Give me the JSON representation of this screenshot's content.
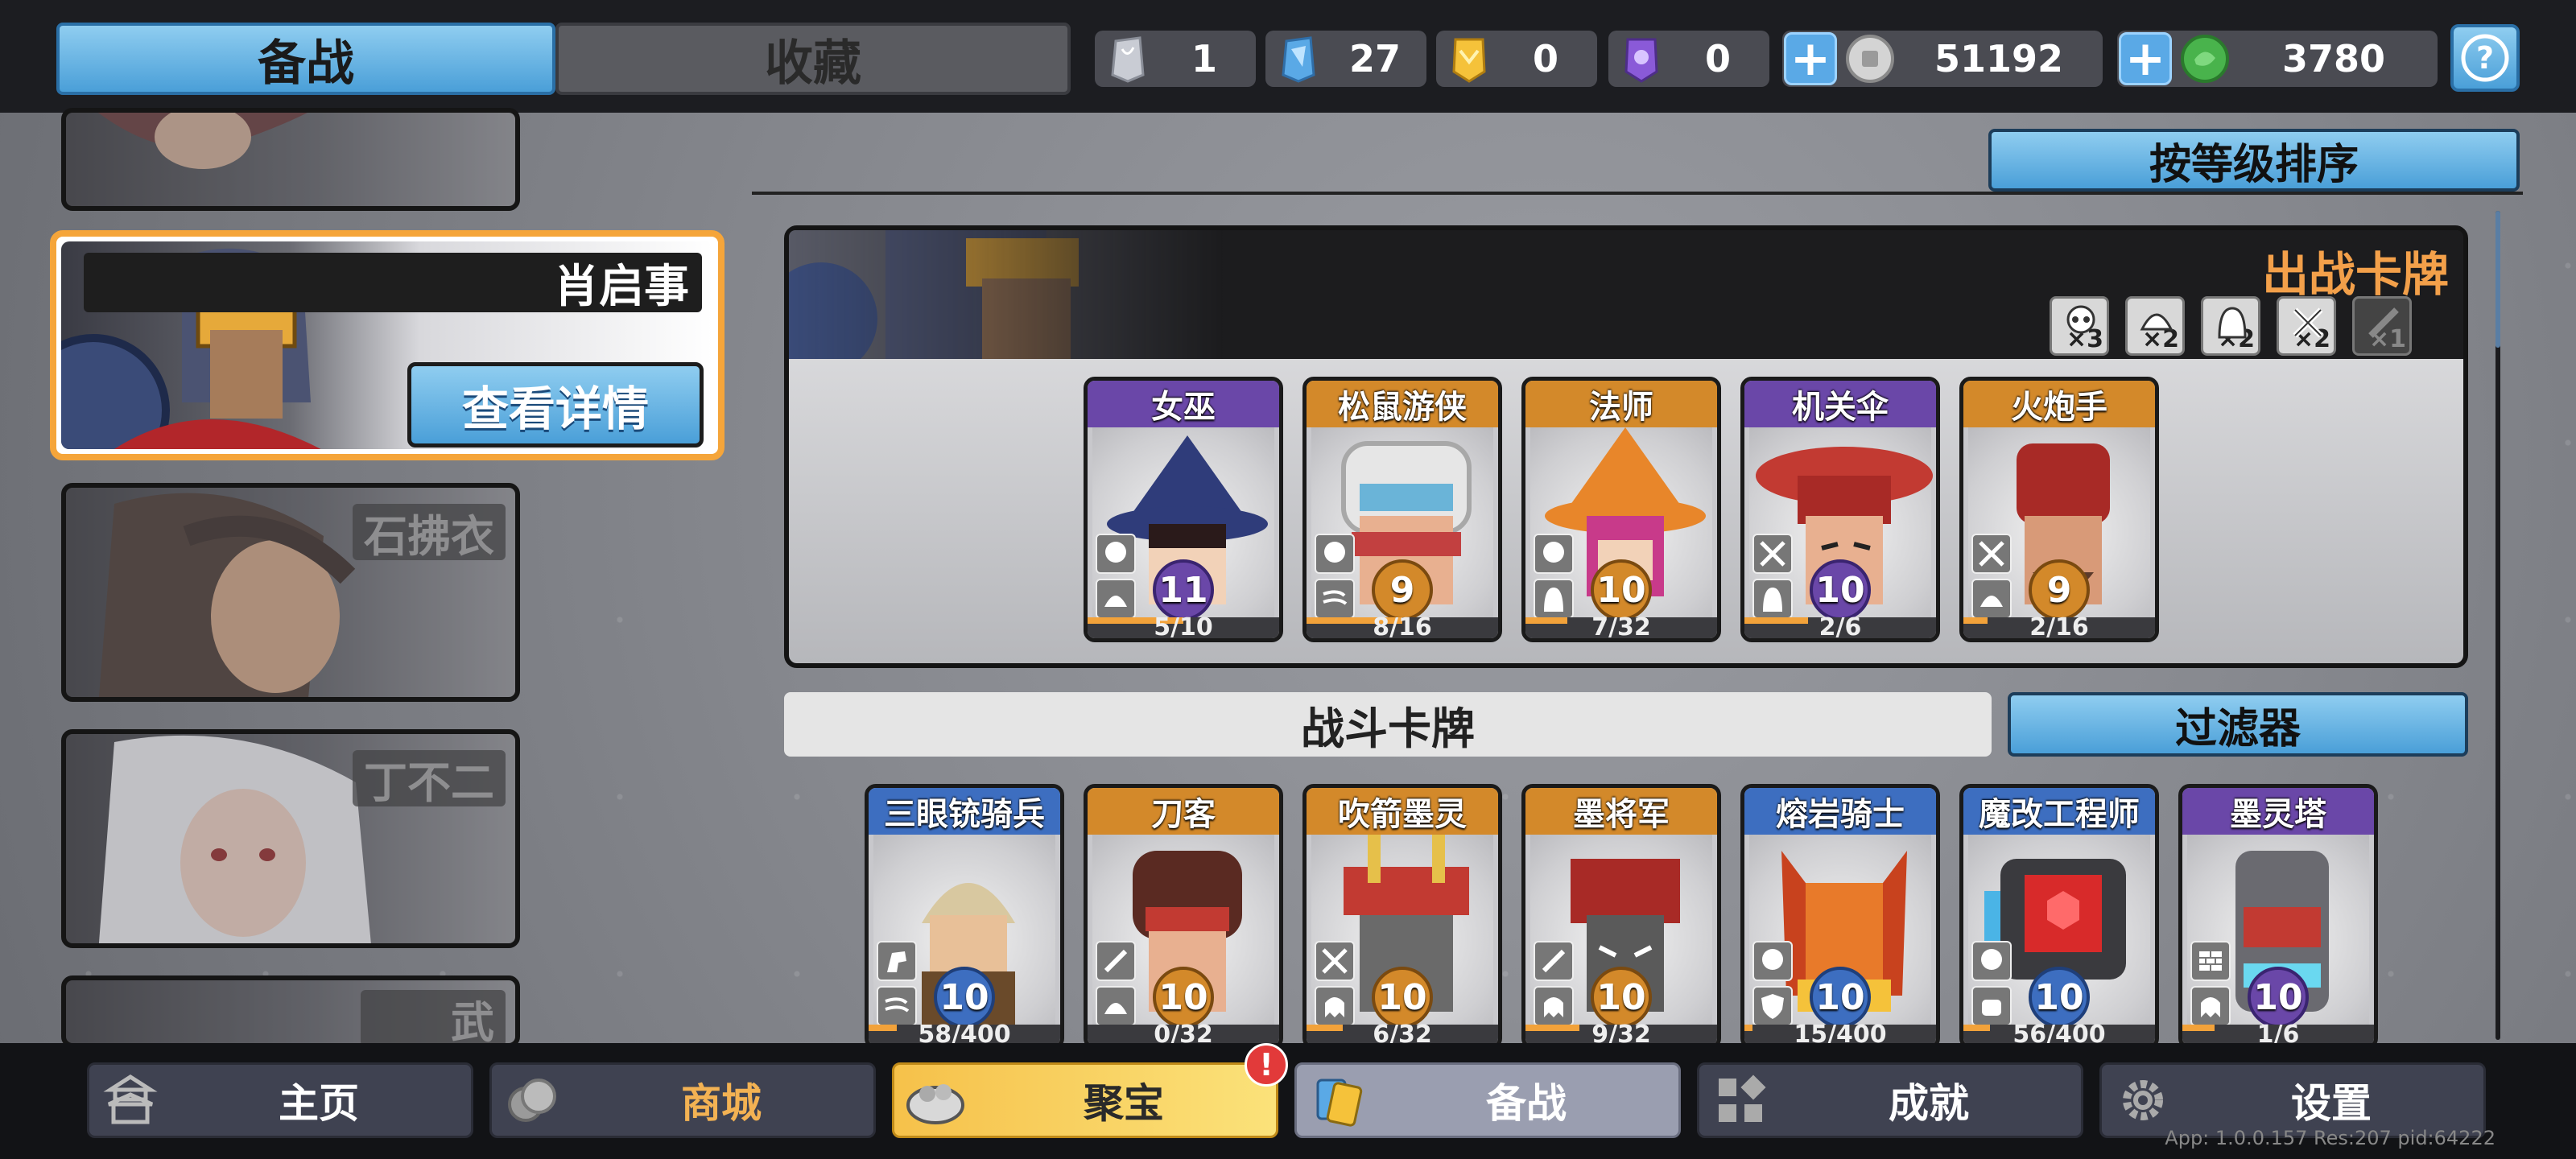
{
  "tabs": [
    {
      "label": "备战",
      "active": true
    },
    {
      "label": "收藏",
      "active": false
    }
  ],
  "resources": [
    {
      "icon": "silver-crystal-icon",
      "value": "1",
      "color": "#c9ccd4"
    },
    {
      "icon": "blue-crystal-icon",
      "value": "27",
      "color": "#5aa9e6"
    },
    {
      "icon": "gold-crystal-icon",
      "value": "0",
      "color": "#f5c23a"
    },
    {
      "icon": "purple-crystal-icon",
      "value": "0",
      "color": "#8a5ad8"
    },
    {
      "icon": "silver-coin-icon",
      "value": "51192",
      "color": "#c8c8c8"
    },
    {
      "icon": "green-gem-icon",
      "value": "3780",
      "color": "#49b34c"
    }
  ],
  "heroes": [
    {
      "name": "肖启事",
      "selected": true,
      "detail_label": "查看详情"
    },
    {
      "name": "石拂衣"
    },
    {
      "name": "丁不二"
    },
    {
      "name": "武"
    }
  ],
  "sort_label": "按等级排序",
  "deck": {
    "title": "出战卡牌",
    "counters": [
      {
        "icon": "skull-icon",
        "count": "×3"
      },
      {
        "icon": "helmet-icon",
        "count": "×2"
      },
      {
        "icon": "hood-icon",
        "count": "×2"
      },
      {
        "icon": "crossed-swords-icon",
        "count": "×2"
      },
      {
        "icon": "blade-icon",
        "count": "×1"
      }
    ],
    "cards": [
      {
        "name": "女巫",
        "level": "11",
        "progress": "5/10",
        "fill": 0.5,
        "rarity": "purple"
      },
      {
        "name": "松鼠游侠",
        "level": "9",
        "progress": "8/16",
        "fill": 0.5,
        "rarity": "orange"
      },
      {
        "name": "法师",
        "level": "10",
        "progress": "7/32",
        "fill": 0.22,
        "rarity": "orange"
      },
      {
        "name": "机关伞",
        "level": "10",
        "progress": "2/6",
        "fill": 0.33,
        "rarity": "purple"
      },
      {
        "name": "火炮手",
        "level": "9",
        "progress": "2/16",
        "fill": 0.125,
        "rarity": "orange"
      }
    ]
  },
  "battle_cards_label": "战斗卡牌",
  "filter_label": "过滤器",
  "battle_cards": [
    {
      "name": "三眼铳骑兵",
      "level": "10",
      "progress": "58/400",
      "fill": 0.145,
      "rarity": "blue"
    },
    {
      "name": "刀客",
      "level": "10",
      "progress": "0/32",
      "fill": 0,
      "rarity": "orange"
    },
    {
      "name": "吹箭墨灵",
      "level": "10",
      "progress": "6/32",
      "fill": 0.19,
      "rarity": "orange"
    },
    {
      "name": "墨将军",
      "level": "10",
      "progress": "9/32",
      "fill": 0.28,
      "rarity": "orange"
    },
    {
      "name": "熔岩骑士",
      "level": "10",
      "progress": "15/400",
      "fill": 0.04,
      "rarity": "blue"
    },
    {
      "name": "魔改工程师",
      "level": "10",
      "progress": "56/400",
      "fill": 0.14,
      "rarity": "blue"
    },
    {
      "name": "墨灵塔",
      "level": "10",
      "progress": "1/6",
      "fill": 0.17,
      "rarity": "purple"
    }
  ],
  "nav": [
    {
      "label": "主页",
      "icon": "pagoda-icon"
    },
    {
      "label": "商城",
      "icon": "coins-icon"
    },
    {
      "label": "聚宝",
      "icon": "treasure-bowl-icon",
      "badge": "!"
    },
    {
      "label": "备战",
      "icon": "cards-icon"
    },
    {
      "label": "成就",
      "icon": "achievement-grid-icon"
    },
    {
      "label": "设置",
      "icon": "gear-icon"
    }
  ],
  "version": "App: 1.0.0.157 Res:207 pid:64222"
}
